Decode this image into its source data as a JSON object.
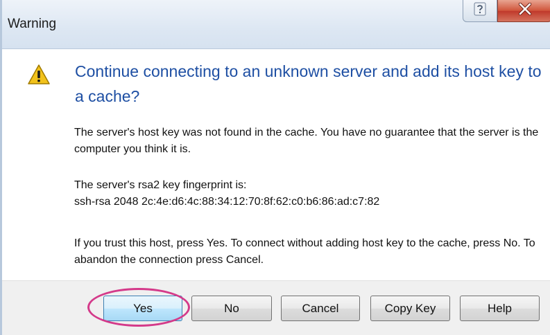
{
  "window": {
    "title": "Warning"
  },
  "titlebar": {
    "help_icon": "question-mark-icon",
    "close_icon": "close-x-icon"
  },
  "content": {
    "icon": "warning-triangle-icon",
    "main_instruction": "Continue connecting to an unknown server and add its host key to a cache?",
    "paragraph_1": "The server's host key was not found in the cache. You have no guarantee that the server is the computer you think it is.",
    "paragraph_2_line_1": "The server's rsa2 key fingerprint is:",
    "paragraph_2_line_2": "ssh-rsa 2048 2c:4e:d6:4c:88:34:12:70:8f:62:c0:b6:86:ad:c7:82",
    "paragraph_3": "If you trust this host, press Yes. To connect without adding host key to the cache, press No. To abandon the connection press Cancel."
  },
  "buttons": {
    "yes": "Yes",
    "no": "No",
    "cancel": "Cancel",
    "copy_key": "Copy Key",
    "help": "Help"
  },
  "colors": {
    "instruction_blue": "#1e4fa3",
    "highlight_ring": "#d43a8a",
    "close_red": "#c0392b",
    "warning_yellow": "#f2c21b"
  }
}
